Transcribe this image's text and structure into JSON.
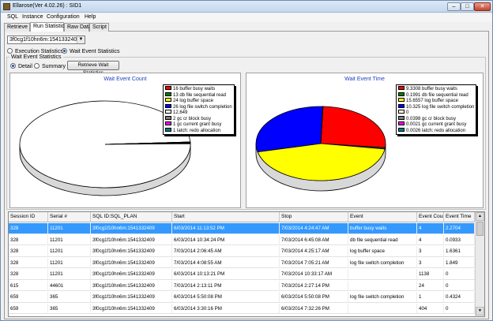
{
  "window": {
    "title": "Ellarose(Ver 4.02.26) : SID1"
  },
  "menu": [
    "SQL",
    "Instance",
    "Configuration",
    "Help"
  ],
  "tabs": [
    "Retrieve",
    "Run Statistics",
    "Raw Data",
    "Script"
  ],
  "sql_select": {
    "value": "3f0cg1f10hn6m:1541332409"
  },
  "stat_mode": {
    "execution": "Execution Statistics",
    "wait_event": "Wait Event Statistics"
  },
  "wait_event": {
    "group_label": "Wait Event Statistics",
    "detail": "Detail",
    "summary": "Summary",
    "retrieve_button": "Retrieve Wait Statistics"
  },
  "colors": {
    "red": "#ff0000",
    "green": "#008000",
    "yellow": "#ffff00",
    "blue": "#0000ff",
    "white": "#ffffff",
    "gray": "#808080",
    "magenta": "#ff00ff",
    "teal": "#008080"
  },
  "chart_data": [
    {
      "type": "pie",
      "title": "Wait Event Count",
      "labels": [
        "buffer busy waits",
        "db file sequential read",
        "log buffer space",
        "log file switch completion",
        "",
        "gc cr block busy",
        "gc current grant busy",
        "latch: redo allocation"
      ],
      "legend": [
        "16 buffer busy waits",
        "13 db file sequential read",
        "24 log buffer space",
        "26 log file switch completion",
        "12,649",
        "2 gc cr block busy",
        "1 gc current grant busy",
        "1 latch: redo allocation"
      ],
      "values": [
        16,
        13,
        24,
        26,
        12649,
        2,
        1,
        1
      ],
      "colors": [
        "#ff0000",
        "#008000",
        "#ffff00",
        "#0000ff",
        "#ffffff",
        "#808080",
        "#ff00ff",
        "#008080"
      ]
    },
    {
      "type": "pie",
      "title": "Wait Event Time",
      "labels": [
        "buffer busy waits",
        "db file sequential read",
        "log buffer space",
        "log file switch completion",
        "",
        "gc cr block busy",
        "gc current grant busy",
        "latch: redo allocation"
      ],
      "legend": [
        "9.3308 buffer busy waits",
        "0.1991 db file sequential read",
        "15.6557 log buffer space",
        "10.325 log file switch completion",
        "0",
        "0.0398 gc cr block busy",
        "0.0021 gc current grant busy",
        "0.0026 latch: redo allocation"
      ],
      "values": [
        9.3308,
        0.1991,
        15.6557,
        10.325,
        0,
        0.0398,
        0.0021,
        0.0026
      ],
      "colors": [
        "#ff0000",
        "#008000",
        "#ffff00",
        "#0000ff",
        "#ffffff",
        "#808080",
        "#ff00ff",
        "#008080"
      ]
    }
  ],
  "grid": {
    "columns": [
      "Session ID",
      "Serial #",
      "SQL ID:SQL_PLAN",
      "Start",
      "Stop",
      "Event",
      "Event Count",
      "Event Time"
    ],
    "rows": [
      [
        "328",
        "11201",
        "3f0cg1f10hn6m:1541332409",
        "6/03/2014 11:13:52 PM",
        "7/03/2014 4:24:47 AM",
        "buffer busy waits",
        "4",
        "2.2704"
      ],
      [
        "328",
        "11201",
        "3f0cg1f10hn6m:1541332409",
        "6/03/2014 10:34:24 PM",
        "7/03/2014 6:45:08 AM",
        "db file sequential read",
        "4",
        "0.0933"
      ],
      [
        "328",
        "11201",
        "3f0cg1f10hn6m:1541332409",
        "7/03/2014 2:06:45 AM",
        "7/03/2014 4:25:17 AM",
        "log buffer space",
        "3",
        "1.6361"
      ],
      [
        "328",
        "11201",
        "3f0cg1f10hn6m:1541332409",
        "7/03/2014 4:08:55 AM",
        "7/03/2014 7:05:21 AM",
        "log file switch completion",
        "3",
        "1.849"
      ],
      [
        "328",
        "11201",
        "3f0cg1f10hn6m:1541332409",
        "6/03/2014 10:13:21 PM",
        "7/03/2014 10:33:17 AM",
        "",
        "1138",
        "0"
      ],
      [
        "615",
        "44601",
        "3f0cg1f10hn6m:1541332409",
        "7/03/2014 2:13:11 PM",
        "7/03/2014 2:27:14 PM",
        "",
        "24",
        "0"
      ],
      [
        "659",
        "365",
        "3f0cg1f10hn6m:1541332409",
        "6/03/2014 5:50:08 PM",
        "6/03/2014 5:50:08 PM",
        "log file switch completion",
        "1",
        "0.4324"
      ],
      [
        "659",
        "365",
        "3f0cg1f10hn6m:1541332409",
        "6/03/2014 3:30:16 PM",
        "6/03/2014 7:32:26 PM",
        "",
        "404",
        "0"
      ]
    ]
  }
}
